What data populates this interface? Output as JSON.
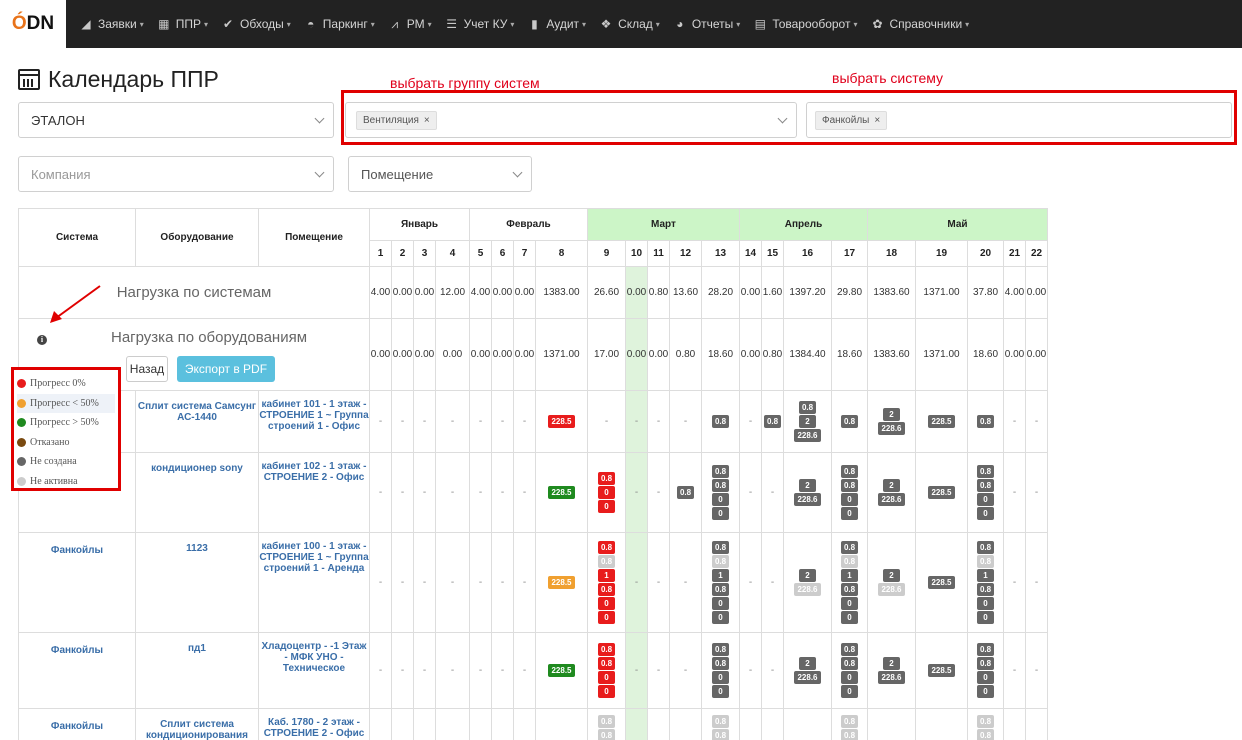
{
  "nav": {
    "logo_o": "Ó",
    "logo_rest": "DN",
    "items": [
      {
        "label": "Заявки",
        "icon": "paper-plane-icon"
      },
      {
        "label": "ППР",
        "icon": "calendar-icon"
      },
      {
        "label": "Обходы",
        "icon": "check-icon"
      },
      {
        "label": "Паркинг",
        "icon": "car-icon"
      },
      {
        "label": "РМ",
        "icon": "line-chart-icon"
      },
      {
        "label": "Учет КУ",
        "icon": "list-icon"
      },
      {
        "label": "Аудит",
        "icon": "bar-chart-icon"
      },
      {
        "label": "Склад",
        "icon": "dropbox-icon"
      },
      {
        "label": "Отчеты",
        "icon": "pie-chart-icon"
      },
      {
        "label": "Товарооборот",
        "icon": "document-icon"
      },
      {
        "label": "Справочники",
        "icon": "gear-icon"
      }
    ]
  },
  "page": {
    "title": "Календарь ППР"
  },
  "annotations": {
    "group_label": "выбрать группу систем",
    "system_label": "выбрать систему"
  },
  "filters": {
    "object_value": "ЭТАЛОН",
    "system_group_tag": "Вентиляция",
    "system_tag": "Фанкойлы",
    "tag_remove": "×",
    "company_placeholder": "Компания",
    "room_placeholder": "Помещение"
  },
  "table": {
    "col_system": "Система",
    "col_equipment": "Оборудование",
    "col_room": "Помещение",
    "months": [
      "Январь",
      "Февраль",
      "Март",
      "Апрель",
      "Май"
    ],
    "weeks": [
      "1",
      "2",
      "3",
      "4",
      "5",
      "6",
      "7",
      "8",
      "9",
      "10",
      "11",
      "12",
      "13",
      "14",
      "15",
      "16",
      "17",
      "18",
      "19",
      "20",
      "21",
      "22"
    ],
    "load_systems_label": "Нагрузка по системам",
    "load_systems": [
      "4.00",
      "0.00",
      "0.00",
      "12.00",
      "4.00",
      "0.00",
      "0.00",
      "1383.00",
      "26.60",
      "0.00",
      "0.80",
      "13.60",
      "28.20",
      "0.00",
      "1.60",
      "1397.20",
      "29.80",
      "1383.60",
      "1371.00",
      "37.80",
      "4.00",
      "0.00"
    ],
    "load_equipment_label": "Нагрузка по оборудованиям",
    "load_equipment": [
      "0.00",
      "0.00",
      "0.00",
      "0.00",
      "0.00",
      "0.00",
      "0.00",
      "1371.00",
      "17.00",
      "0.00",
      "0.00",
      "0.80",
      "18.60",
      "0.00",
      "0.80",
      "1384.40",
      "18.60",
      "1383.60",
      "1371.00",
      "18.60",
      "0.00",
      "0.00"
    ],
    "back_button": "Назад",
    "pdf_button": "Экспорт в PDF",
    "dash": "-",
    "rows": [
      {
        "system": "",
        "equipment": "Сплит система Самсунг АС-1440",
        "room": "кабинет 101 - 1 этаж - СТРОЕНИЕ 1 ~ Группа строений 1 - Офис"
      },
      {
        "system": "",
        "equipment": "кондиционер sony",
        "room": "кабинет 102 - 1 этаж - СТРОЕНИЕ 2 - Офис"
      },
      {
        "system": "Фанкойлы",
        "equipment": "1123",
        "room": "кабинет 100 - 1 этаж - СТРОЕНИЕ 1 ~ Группа строений 1 - Аренда"
      },
      {
        "system": "Фанкойлы",
        "equipment": "пд1",
        "room": "Хладоцентр - -1 Этаж - МФК УНО - Техническое"
      },
      {
        "system": "Фанкойлы",
        "equipment": "Сплит система кондиционирования",
        "room": "Каб. 1780 - 2 этаж - СТРОЕНИЕ 2 - Офис"
      }
    ],
    "badges": {
      "v228_5": "228.5",
      "v228_6": "228.6",
      "v0_8": "0.8",
      "v0": "0",
      "v1": "1",
      "v2": "2"
    }
  },
  "legend": {
    "items": [
      {
        "label": "Прогресс 0%",
        "color": "#e81c1c"
      },
      {
        "label": "Прогресс < 50%",
        "color": "#f0a030"
      },
      {
        "label": "Прогресс > 50%",
        "color": "#1f8a1f"
      },
      {
        "label": "Отказано",
        "color": "#7a4a10"
      },
      {
        "label": "Не создана",
        "color": "#666666"
      },
      {
        "label": "Не активна",
        "color": "#cccccc"
      }
    ]
  },
  "colors": {
    "accent": "#5bc0de",
    "annotation": "#e00000",
    "march_header": "#ccf5c7"
  }
}
